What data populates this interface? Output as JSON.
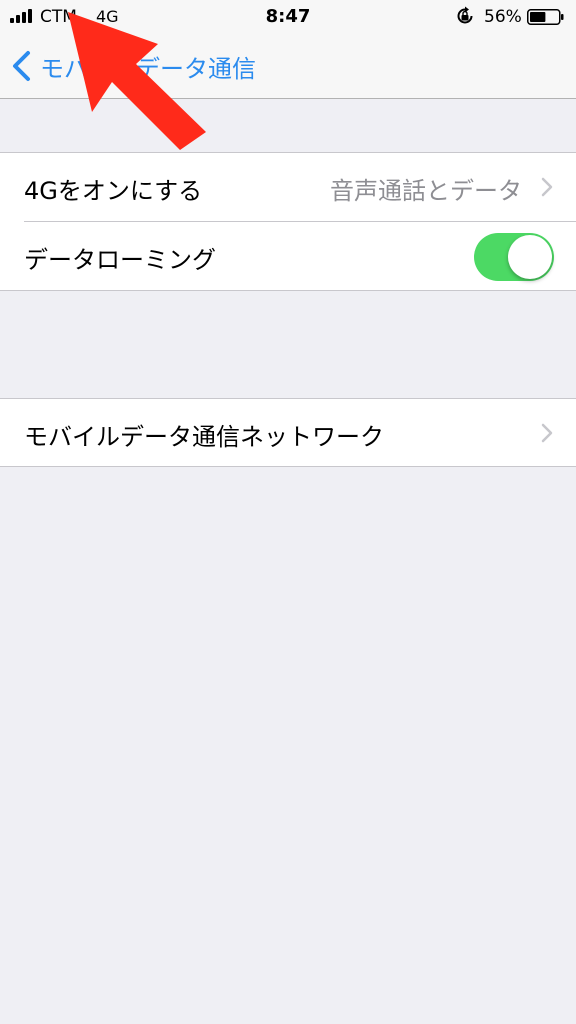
{
  "status_bar": {
    "carrier": "CTM",
    "network_type": "4G",
    "time": "8:47",
    "battery_percent": "56%",
    "battery_level": 0.56
  },
  "nav": {
    "back_label": "モバイルデータ通信"
  },
  "settings": {
    "enable_4g": {
      "label": "4Gをオンにする",
      "value": "音声通話とデータ"
    },
    "data_roaming": {
      "label": "データローミング",
      "enabled": true
    },
    "cellular_network": {
      "label": "モバイルデータ通信ネットワーク"
    }
  },
  "colors": {
    "accent": "#2b8bee",
    "toggle_on": "#4cd964",
    "annotation_arrow": "#ff2a1a"
  },
  "icons": [
    "signal-icon",
    "rotation-lock-icon",
    "battery-icon",
    "chevron-left-icon",
    "chevron-right-icon",
    "annotation-arrow-icon"
  ]
}
